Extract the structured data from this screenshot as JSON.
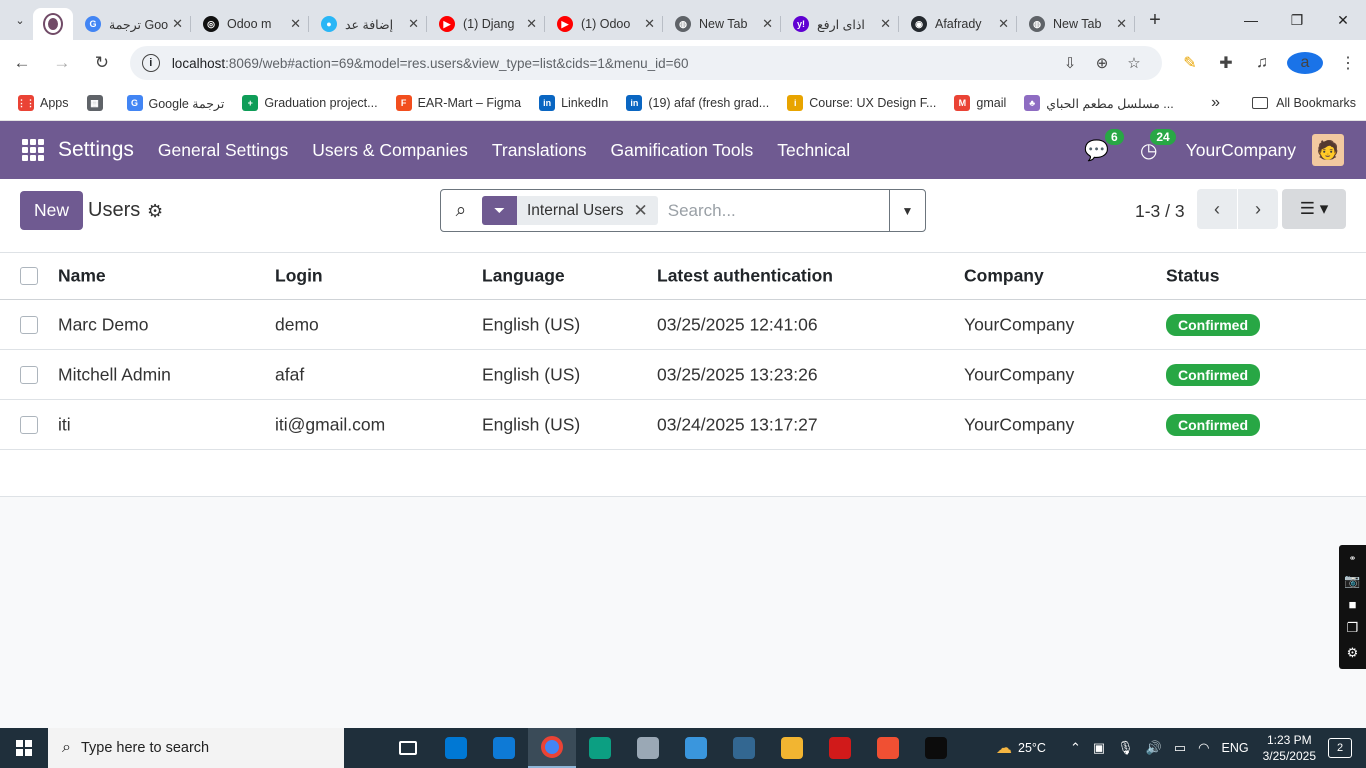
{
  "browser": {
    "tabs": [
      {
        "title": "",
        "favicon": "#714b67",
        "active": true
      },
      {
        "title": "ترجمة Google",
        "favicon": "#4285f4",
        "icon": "G"
      },
      {
        "title": "Odoo m",
        "favicon": "#111111",
        "icon": "◎"
      },
      {
        "title": "إضافة عد",
        "favicon": "#29b6f6",
        "icon": "●"
      },
      {
        "title": "(1) Djang",
        "favicon": "#ff0000",
        "icon": "▶"
      },
      {
        "title": "(1) Odoo",
        "favicon": "#ff0000",
        "icon": "▶"
      },
      {
        "title": "New Tab",
        "favicon": "#5f6368",
        "icon": "◍"
      },
      {
        "title": "اذاى ارفع",
        "favicon": "#6001d2",
        "icon": "y!"
      },
      {
        "title": "Afafrady",
        "favicon": "#24292e",
        "icon": "◉"
      },
      {
        "title": "New Tab",
        "favicon": "#5f6368",
        "icon": "◍"
      }
    ],
    "url_host": "localhost",
    "url_rest": ":8069/web#action=69&model=res.users&view_type=list&cids=1&menu_id=60",
    "profile_letter": "a",
    "bookmarks": [
      {
        "label": "Apps",
        "color": "#ea4335",
        "icon": "⋮⋮"
      },
      {
        "label": "",
        "color": "#5f6368",
        "icon": "▦"
      },
      {
        "label": "Google ترجمة",
        "color": "#4285f4",
        "icon": "G"
      },
      {
        "label": "Graduation project...",
        "color": "#0f9d58",
        "icon": "+"
      },
      {
        "label": "EAR-Mart – Figma",
        "color": "#f24e1e",
        "icon": "F"
      },
      {
        "label": "LinkedIn",
        "color": "#0a66c2",
        "icon": "in"
      },
      {
        "label": "(19) afaf (fresh grad...",
        "color": "#0a66c2",
        "icon": "in"
      },
      {
        "label": "Course: UX Design F...",
        "color": "#e8a400",
        "icon": "i"
      },
      {
        "label": "gmail",
        "color": "#ea4335",
        "icon": "M"
      },
      {
        "label": "مسلسل مطعم الحباي ...",
        "color": "#8e6cc2",
        "icon": "♣"
      }
    ],
    "all_bookmarks": "All Bookmarks"
  },
  "odoo": {
    "app_name": "Settings",
    "menu": [
      "General Settings",
      "Users & Companies",
      "Translations",
      "Gamification Tools",
      "Technical"
    ],
    "messages_count": "6",
    "activities_count": "24",
    "company": "YourCompany",
    "new_label": "New",
    "breadcrumb": "Users",
    "facet_value": "Internal Users",
    "search_placeholder": "Search...",
    "pager": "1-3 / 3",
    "columns": [
      "Name",
      "Login",
      "Language",
      "Latest authentication",
      "Company",
      "Status"
    ],
    "rows": [
      {
        "name": "Marc Demo",
        "login": "demo",
        "language": "English (US)",
        "auth": "03/25/2025 12:41:06",
        "company": "YourCompany",
        "status": "Confirmed"
      },
      {
        "name": "Mitchell Admin",
        "login": "afaf",
        "language": "English (US)",
        "auth": "03/25/2025 13:23:26",
        "company": "YourCompany",
        "status": "Confirmed"
      },
      {
        "name": "iti",
        "login": "iti@gmail.com",
        "language": "English (US)",
        "auth": "03/24/2025 13:17:27",
        "company": "YourCompany",
        "status": "Confirmed"
      }
    ],
    "brand_color": "#6f5a91",
    "status_color": "#28a745"
  },
  "taskbar": {
    "search_placeholder": "Type here to search",
    "weather": "25°C",
    "language": "ENG",
    "time": "1:23 PM",
    "date": "3/25/2025",
    "notifications": "2",
    "apps": [
      {
        "name": "task-view",
        "color": "#1f2f3b"
      },
      {
        "name": "vscode",
        "color": "#0078d4"
      },
      {
        "name": "visual-studio-installer",
        "color": "#0e7ad6"
      },
      {
        "name": "chrome",
        "color": "#4285f4"
      },
      {
        "name": "edge",
        "color": "#0c9f82"
      },
      {
        "name": "settings-gear",
        "color": "#9aa8b5"
      },
      {
        "name": "azure-data",
        "color": "#3a96dd"
      },
      {
        "name": "postgres",
        "color": "#336791"
      },
      {
        "name": "file-explorer",
        "color": "#f2b531"
      },
      {
        "name": "recorder",
        "color": "#d11a1a"
      },
      {
        "name": "git",
        "color": "#f05033"
      },
      {
        "name": "terminal",
        "color": "#0c0c0c"
      }
    ]
  }
}
